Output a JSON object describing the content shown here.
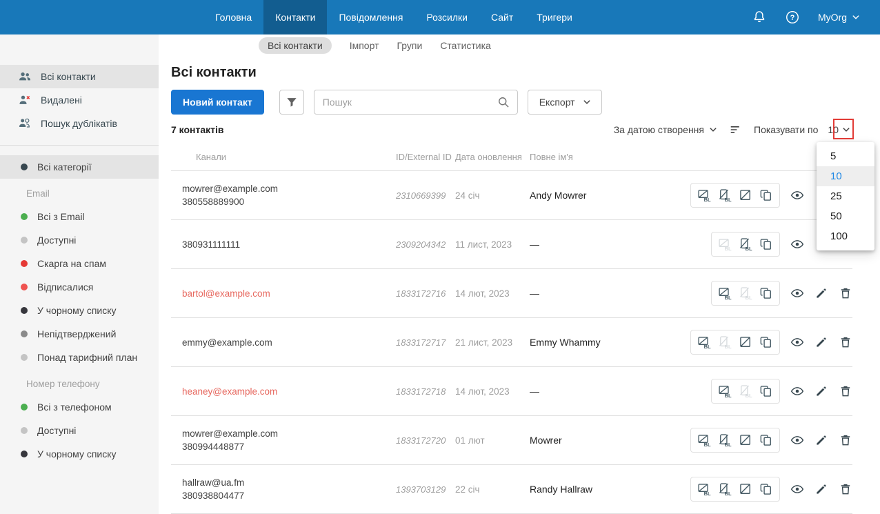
{
  "colors": {
    "nav_blue": "#1878b9",
    "accent_blue": "#1976d2",
    "selected_option_blue": "#1e88e5",
    "red_text": "#e7685f",
    "annotation_red": "#e23b36"
  },
  "topnav": {
    "org_name": "MyOrg",
    "items": [
      {
        "label": "Головна",
        "active": false
      },
      {
        "label": "Контакти",
        "active": true
      },
      {
        "label": "Повідомлення",
        "active": false
      },
      {
        "label": "Розсилки",
        "active": false
      },
      {
        "label": "Сайт",
        "active": false
      },
      {
        "label": "Тригери",
        "active": false
      }
    ]
  },
  "subnav": {
    "items": [
      {
        "label": "Всі контакти",
        "active": true
      },
      {
        "label": "Імпорт",
        "active": false
      },
      {
        "label": "Групи",
        "active": false
      },
      {
        "label": "Статистика",
        "active": false
      }
    ]
  },
  "sidebar": {
    "top_items": [
      {
        "label": "Всі контакти",
        "icon": "contacts-icon",
        "selected": true
      },
      {
        "label": "Видалені",
        "icon": "deleted-contact-icon",
        "selected": false
      },
      {
        "label": "Пошук дублікатів",
        "icon": "duplicates-icon",
        "selected": false
      }
    ],
    "all_categories": {
      "label": "Всі категорії",
      "dot_color": "#37474f",
      "selected": true
    },
    "sections": [
      {
        "header": "Email",
        "items": [
          {
            "label": "Всі з Email",
            "dot_color": "#4caf50"
          },
          {
            "label": "Доступні",
            "dot_color": "#c4c4c4"
          },
          {
            "label": "Скарга на спам",
            "dot_color": "#e53935"
          },
          {
            "label": "Відписалися",
            "dot_color": "#ef5350"
          },
          {
            "label": "У чорному списку",
            "dot_color": "#37373d"
          },
          {
            "label": "Непідтверджений",
            "dot_color": "#8a8a8a"
          },
          {
            "label": "Понад тарифний план",
            "dot_color": "#c4c4c4"
          }
        ]
      },
      {
        "header": "Номер телефону",
        "items": [
          {
            "label": "Всі з телефоном",
            "dot_color": "#4caf50"
          },
          {
            "label": "Доступні",
            "dot_color": "#c4c4c4"
          },
          {
            "label": "У чорному списку",
            "dot_color": "#37373d"
          }
        ]
      }
    ]
  },
  "main": {
    "title": "Всі контакти",
    "new_contact_button": "Новий контакт",
    "search_placeholder": "Пошук",
    "export_button": "Експорт",
    "count_label": "7 контактів",
    "sort_label": "За датою створення",
    "per_page_label": "Показувати по",
    "per_page_value": "10",
    "table": {
      "headers": [
        "Канали",
        "ID/External ID",
        "Дата оновлення",
        "Повне ім'я"
      ],
      "rows": [
        {
          "channels": [
            {
              "text": "mowrer@example.com",
              "red": false
            },
            {
              "text": "380558889900",
              "red": false
            }
          ],
          "id": "2310669399",
          "date": "24 січ",
          "name": "Andy Mowrer",
          "box_icons": [
            {
              "icon": "email-blacklist-icon",
              "disabled": false
            },
            {
              "icon": "phone-blacklist-icon",
              "disabled": false
            },
            {
              "icon": "variables-icon",
              "disabled": false
            },
            {
              "icon": "copy-icon",
              "disabled": false
            }
          ]
        },
        {
          "channels": [
            {
              "text": "380931111111",
              "red": false
            }
          ],
          "id": "2309204342",
          "date": "11 лист, 2023",
          "name": "—",
          "box_icons": [
            {
              "icon": "email-blacklist-icon",
              "disabled": true
            },
            {
              "icon": "phone-blacklist-icon",
              "disabled": false
            },
            {
              "icon": "copy-icon",
              "disabled": false
            }
          ]
        },
        {
          "channels": [
            {
              "text": "bartol@example.com",
              "red": true
            }
          ],
          "id": "1833172716",
          "date": "14 лют, 2023",
          "name": "—",
          "box_icons": [
            {
              "icon": "email-blacklist-icon",
              "disabled": false
            },
            {
              "icon": "phone-blacklist-icon",
              "disabled": true
            },
            {
              "icon": "copy-icon",
              "disabled": false
            }
          ]
        },
        {
          "channels": [
            {
              "text": "emmy@example.com",
              "red": false
            }
          ],
          "id": "1833172717",
          "date": "21 лист, 2023",
          "name": "Emmy Whammy",
          "box_icons": [
            {
              "icon": "email-blacklist-icon",
              "disabled": false
            },
            {
              "icon": "phone-blacklist-icon",
              "disabled": true
            },
            {
              "icon": "variables-icon",
              "disabled": false
            },
            {
              "icon": "copy-icon",
              "disabled": false
            }
          ]
        },
        {
          "channels": [
            {
              "text": "heaney@example.com",
              "red": true
            }
          ],
          "id": "1833172718",
          "date": "14 лют, 2023",
          "name": "—",
          "box_icons": [
            {
              "icon": "email-blacklist-icon",
              "disabled": false
            },
            {
              "icon": "phone-blacklist-icon",
              "disabled": true
            },
            {
              "icon": "copy-icon",
              "disabled": false
            }
          ]
        },
        {
          "channels": [
            {
              "text": "mowrer@example.com",
              "red": false
            },
            {
              "text": "380994448877",
              "red": false
            }
          ],
          "id": "1833172720",
          "date": "01 лют",
          "name": "Mowrer",
          "box_icons": [
            {
              "icon": "email-blacklist-icon",
              "disabled": false
            },
            {
              "icon": "phone-blacklist-icon",
              "disabled": false
            },
            {
              "icon": "variables-icon",
              "disabled": false
            },
            {
              "icon": "copy-icon",
              "disabled": false
            }
          ]
        },
        {
          "channels": [
            {
              "text": "hallraw@ua.fm",
              "red": false
            },
            {
              "text": "380938804477",
              "red": false
            }
          ],
          "id": "1393703129",
          "date": "22 січ",
          "name": "Randy Hallraw",
          "box_icons": [
            {
              "icon": "email-blacklist-icon",
              "disabled": false
            },
            {
              "icon": "phone-blacklist-icon",
              "disabled": false
            },
            {
              "icon": "variables-icon",
              "disabled": false
            },
            {
              "icon": "copy-icon",
              "disabled": false
            }
          ]
        }
      ]
    }
  },
  "per_page_menu": {
    "options": [
      "5",
      "10",
      "25",
      "50",
      "100"
    ],
    "selected": "10"
  }
}
